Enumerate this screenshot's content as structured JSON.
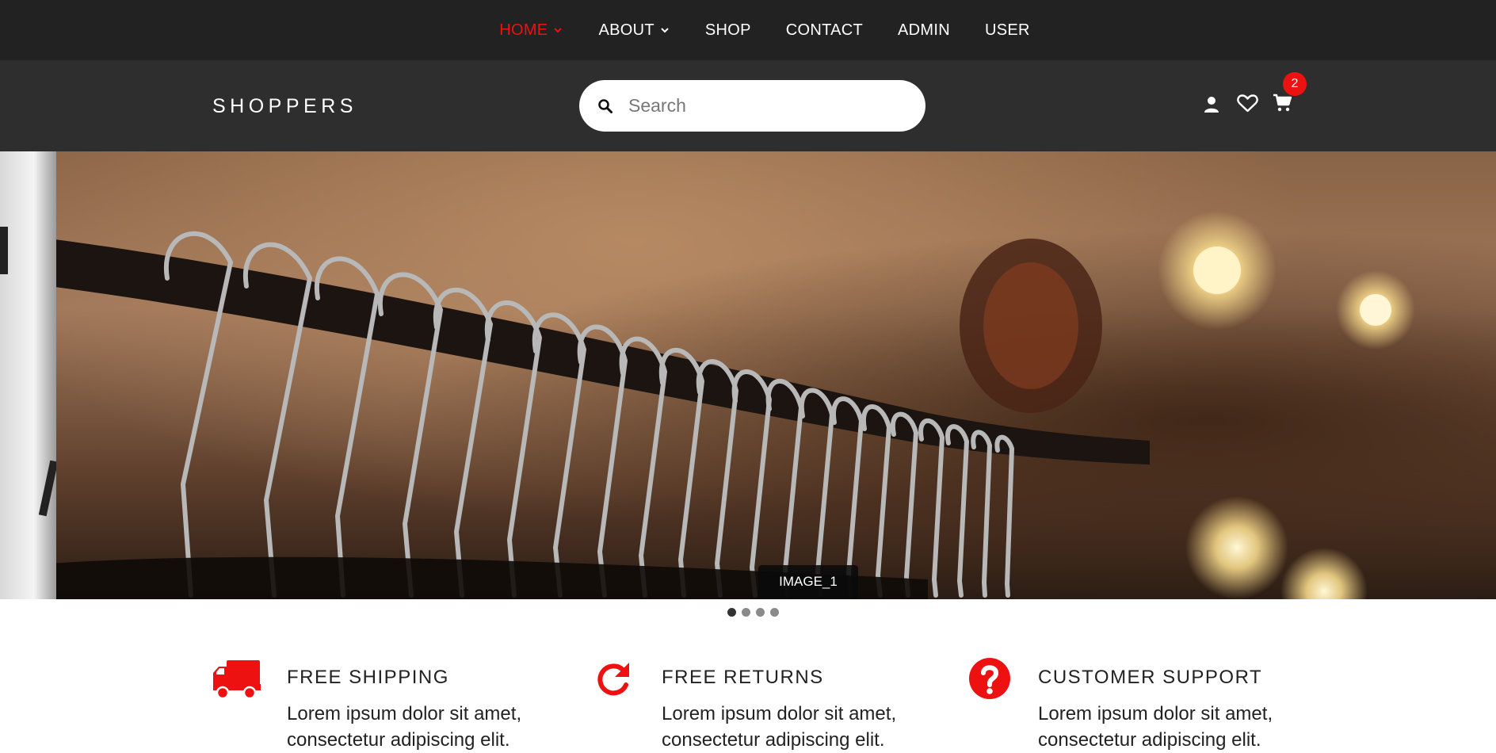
{
  "nav": {
    "items": [
      {
        "label": "HOME",
        "has_dropdown": true,
        "active": true
      },
      {
        "label": "ABOUT",
        "has_dropdown": true,
        "active": false
      },
      {
        "label": "SHOP",
        "has_dropdown": false,
        "active": false
      },
      {
        "label": "CONTACT",
        "has_dropdown": false,
        "active": false
      },
      {
        "label": "ADMIN",
        "has_dropdown": false,
        "active": false
      },
      {
        "label": "USER",
        "has_dropdown": false,
        "active": false
      }
    ]
  },
  "header": {
    "logo": "SHOPPERS",
    "search_placeholder": "Search",
    "icons": [
      "user-icon",
      "heart-icon",
      "cart-icon"
    ],
    "cart_count": "2"
  },
  "hero": {
    "caption": "IMAGE_1",
    "slide_count": 4,
    "active_slide": 0
  },
  "features": [
    {
      "icon": "truck-icon",
      "title": "FREE SHIPPING",
      "text": "Lorem ipsum dolor sit amet, consectetur adipiscing elit."
    },
    {
      "icon": "refresh-icon",
      "title": "FREE RETURNS",
      "text": "Lorem ipsum dolor sit amet, consectetur adipiscing elit."
    },
    {
      "icon": "question-icon",
      "title": "CUSTOMER SUPPORT",
      "text": "Lorem ipsum dolor sit amet, consectetur adipiscing elit."
    }
  ],
  "colors": {
    "accent": "#ee1111",
    "topnav_bg": "#222222",
    "header_bg": "#2e2e2e"
  }
}
